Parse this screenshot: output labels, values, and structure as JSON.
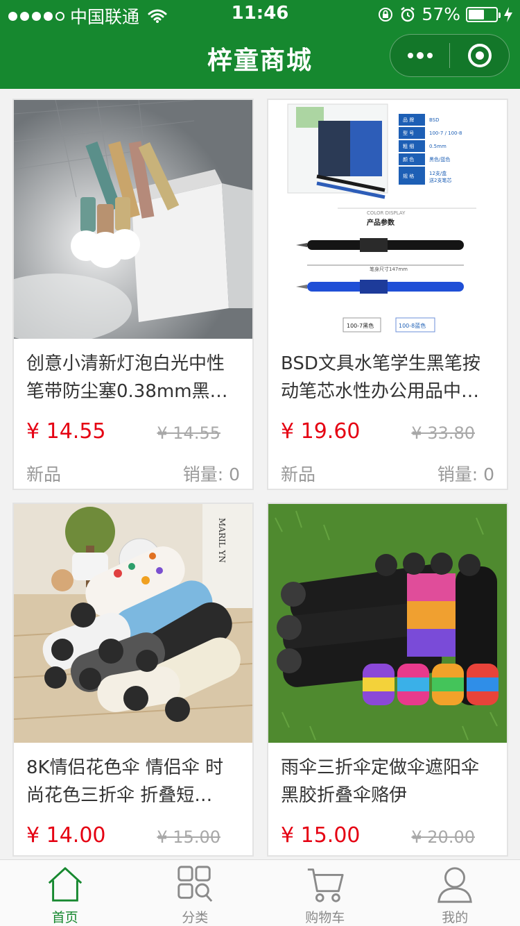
{
  "status_bar": {
    "carrier": "中国联通",
    "time": "11:46",
    "battery": "57%",
    "battery_level": 0.57
  },
  "header": {
    "title": "梓童商城"
  },
  "products": [
    {
      "title": "创意小清新灯泡白光中性笔带防尘塞0.38mm黑…",
      "price": "¥ 14.55",
      "original_price": "¥ 14.55",
      "tag": "新品",
      "sales": "销量:  0"
    },
    {
      "title": "BSD文具水笔学生黑笔按动笔芯水性办公用品中…",
      "price": "¥ 19.60",
      "original_price": "¥ 33.80",
      "tag": "新品",
      "sales": "销量:  0"
    },
    {
      "title": "8K情侣花色伞 情侣伞 时尚花色三折伞 折叠短…",
      "price": "¥ 14.00",
      "original_price": "¥ 15.00",
      "tag": "",
      "sales": ""
    },
    {
      "title": "雨伞三折伞定做伞遮阳伞黑胶折叠伞赂伊",
      "price": "¥ 15.00",
      "original_price": "¥ 20.00",
      "tag": "",
      "sales": ""
    }
  ],
  "spec_card": {
    "rows": [
      {
        "k": "品 牌",
        "v": "BSD"
      },
      {
        "k": "型 号",
        "v": "100-7 / 100-8"
      },
      {
        "k": "粗 细",
        "v": "0.5mm"
      },
      {
        "k": "颜 色",
        "v": "黑色/蓝色"
      },
      {
        "k": "规 格",
        "v": "12支/盒"
      }
    ],
    "spec_extra": "送2支笔芯",
    "color_display": "COLOR DISPLAY",
    "params_title": "产品参数",
    "size_note": "笔身尺寸147mm",
    "label_black": "100-7黑色",
    "label_blue": "100-8蓝色"
  },
  "umbrella_brand": "MARIL YN",
  "tabs": [
    {
      "label": "首页",
      "icon": "home-icon",
      "active": true
    },
    {
      "label": "分类",
      "icon": "category-icon",
      "active": false
    },
    {
      "label": "购物车",
      "icon": "cart-icon",
      "active": false
    },
    {
      "label": "我的",
      "icon": "profile-icon",
      "active": false
    }
  ],
  "colors": {
    "brand_green": "#16882f",
    "price_red": "#e50012"
  }
}
